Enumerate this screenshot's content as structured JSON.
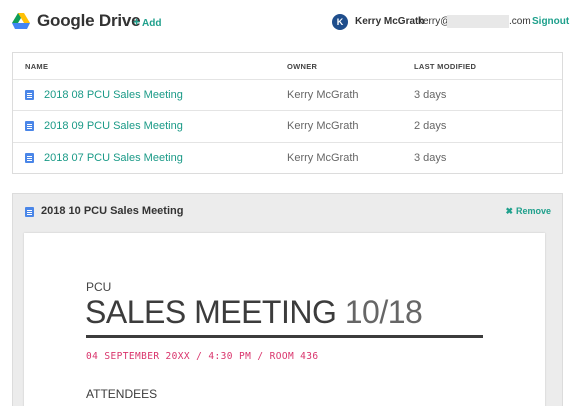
{
  "header": {
    "app_title": "Google Drive",
    "add_label": "Add",
    "add_icon": "plus-icon",
    "user_initial": "K",
    "user_name": "Kerry McGrath",
    "email_prefix": "kerry@",
    "email_suffix": ".com",
    "signout_label": "Signout"
  },
  "table": {
    "headers": {
      "name": "NAME",
      "owner": "OWNER",
      "modified": "LAST MODIFIED"
    },
    "rows": [
      {
        "name": "2018 08 PCU Sales Meeting",
        "owner": "Kerry McGrath",
        "modified": "3 days"
      },
      {
        "name": "2018 09 PCU Sales Meeting",
        "owner": "Kerry McGrath",
        "modified": "2 days"
      },
      {
        "name": "2018 07 PCU Sales Meeting",
        "owner": "Kerry McGrath",
        "modified": "3 days"
      }
    ]
  },
  "preview": {
    "title": "2018 10 PCU Sales Meeting",
    "remove_label": "Remove",
    "doc": {
      "kicker": "PCU",
      "heading_main": "SALES MEETING",
      "heading_num": "10/18",
      "meta": "04 SEPTEMBER 20XX / 4:30 PM / ROOM 436",
      "section": "ATTENDEES"
    }
  },
  "colors": {
    "accent": "#1fa08c",
    "link": "#1a9a87",
    "doc_icon": "#4a86e8",
    "meta_pink": "#d9336b",
    "avatar_bg": "#1f4e8c"
  }
}
